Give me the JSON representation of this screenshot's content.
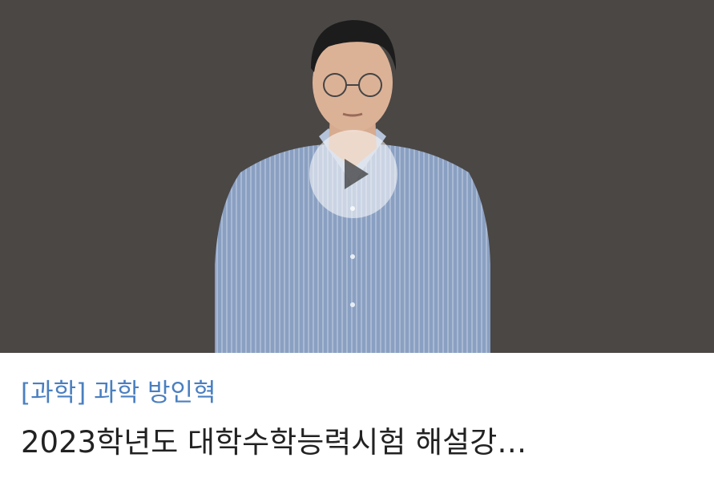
{
  "lecture_card": {
    "category_label": "[과학] 과학 방인혁",
    "title": "2023학년도 대학수학능력시험 해설강…",
    "play_icon": "play-icon",
    "colors": {
      "thumbnail_bg": "#4a4745",
      "category": "#4a7fc0",
      "title": "#222222"
    }
  }
}
